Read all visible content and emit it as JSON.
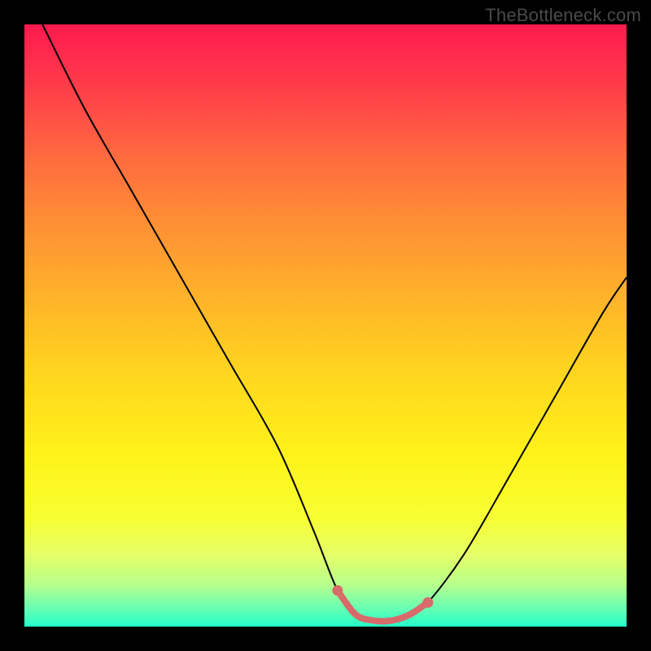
{
  "watermark": "TheBottleneck.com",
  "chart_data": {
    "type": "line",
    "title": "",
    "xlabel": "",
    "ylabel": "",
    "xlim": [
      0,
      100
    ],
    "ylim": [
      0,
      100
    ],
    "series": [
      {
        "name": "bottleneck-curve",
        "x": [
          3,
          10,
          18,
          26,
          34,
          42,
          48,
          52,
          55,
          58,
          61,
          64,
          67,
          73,
          80,
          88,
          96,
          100
        ],
        "values": [
          100,
          86,
          72,
          58,
          44,
          30,
          16,
          6,
          2,
          1,
          1,
          2,
          4,
          12,
          24,
          38,
          52,
          58
        ]
      },
      {
        "name": "optimal-segment",
        "x": [
          52,
          55,
          58,
          61,
          64,
          67
        ],
        "values": [
          6,
          2,
          1,
          1,
          2,
          4
        ]
      }
    ],
    "annotations": []
  },
  "colors": {
    "curve": "#000000",
    "segment": "#d86a6a",
    "background_top": "#ff1a4f",
    "background_bottom": "#23ffc8"
  }
}
